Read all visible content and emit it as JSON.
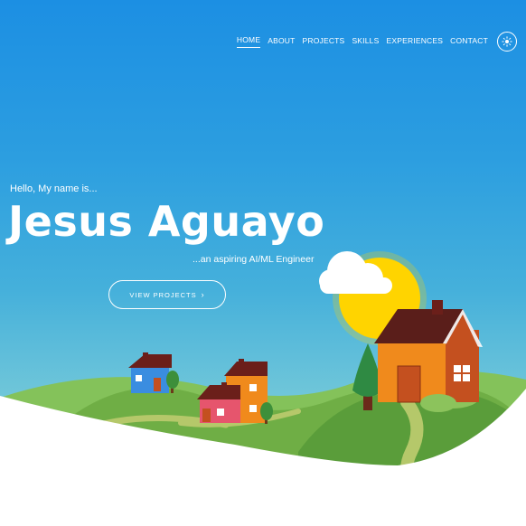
{
  "nav": {
    "items": [
      {
        "label": "HOME",
        "active": true
      },
      {
        "label": "ABOUT",
        "active": false
      },
      {
        "label": "PROJECTS",
        "active": false
      },
      {
        "label": "SKILLS",
        "active": false
      },
      {
        "label": "EXPERIENCES",
        "active": false
      },
      {
        "label": "CONTACT",
        "active": false
      }
    ],
    "theme_toggle_icon": "sun-icon"
  },
  "hero": {
    "greeting": "Hello, My name is...",
    "name": "Jesus Aguayo",
    "tagline": "...an aspiring AI/ML Engineer",
    "cta_label": "VIEW PROJECTS",
    "cta_icon": "chevron-right-icon"
  },
  "colors": {
    "sky_top": "#1c8fe3",
    "sky_bottom": "#92d5d8",
    "hill": "#6fae45",
    "path": "#b5c86a",
    "sun": "#ffd400",
    "house_orange": "#f08a1c"
  }
}
